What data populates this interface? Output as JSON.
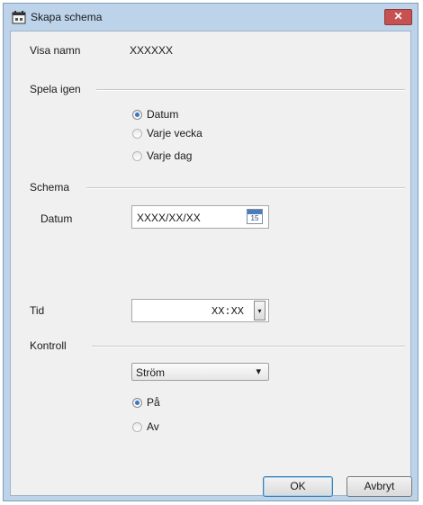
{
  "window": {
    "title": "Skapa schema",
    "close_glyph": "✕"
  },
  "display_name": {
    "label": "Visa namn",
    "value": "XXXXXX"
  },
  "repeat": {
    "title": "Spela igen",
    "options": [
      {
        "label": "Datum",
        "checked": true
      },
      {
        "label": "Varje vecka",
        "checked": false
      },
      {
        "label": "Varje dag",
        "checked": false
      }
    ]
  },
  "schedule": {
    "title": "Schema",
    "date_label": "Datum",
    "date_value": "XXXX/XX/XX",
    "calendar_day": "15",
    "time_label": "Tid",
    "time_value": "XX:XX",
    "spinner_glyph": "▾"
  },
  "control": {
    "title": "Kontroll",
    "select_value": "Ström",
    "select_arrow": "▾",
    "options": [
      {
        "label": "På",
        "checked": true
      },
      {
        "label": "Av",
        "checked": false
      }
    ]
  },
  "buttons": {
    "ok": "OK",
    "cancel": "Avbryt"
  },
  "icons": {
    "app": "schedule-app-icon",
    "calendar": "calendar-icon"
  }
}
